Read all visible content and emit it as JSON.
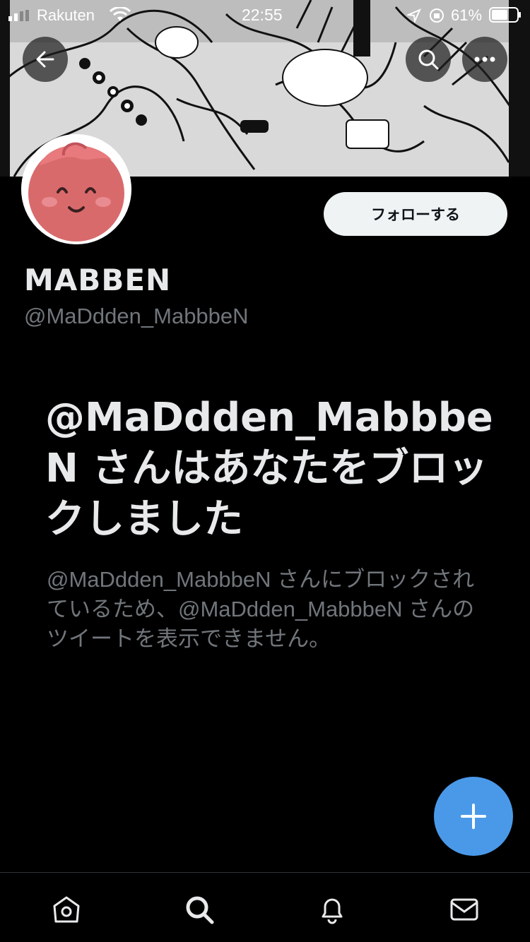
{
  "status_bar": {
    "carrier": "Rakuten",
    "time": "22:55",
    "battery": "61%"
  },
  "profile": {
    "display_name": "MABBEN",
    "handle": "@MaDdden_MabbbeN",
    "follow_label": "フォローする"
  },
  "blocked": {
    "title": "@MaDdden_MabbbeN さんはあなたをブロックしました",
    "description": "@MaDdden_MabbbeN さんにブロックされているため、@MaDdden_MabbbeN さんのツイートを表示できません。"
  },
  "icons": {
    "back": "arrow-left-icon",
    "search": "search-icon",
    "more": "more-horizontal-icon",
    "compose": "plus-icon",
    "tabs": [
      "home-icon",
      "search-icon",
      "bell-icon",
      "mail-icon"
    ]
  },
  "colors": {
    "background": "#000000",
    "accent": "#4a99e9",
    "secondary_text": "#71767b"
  }
}
